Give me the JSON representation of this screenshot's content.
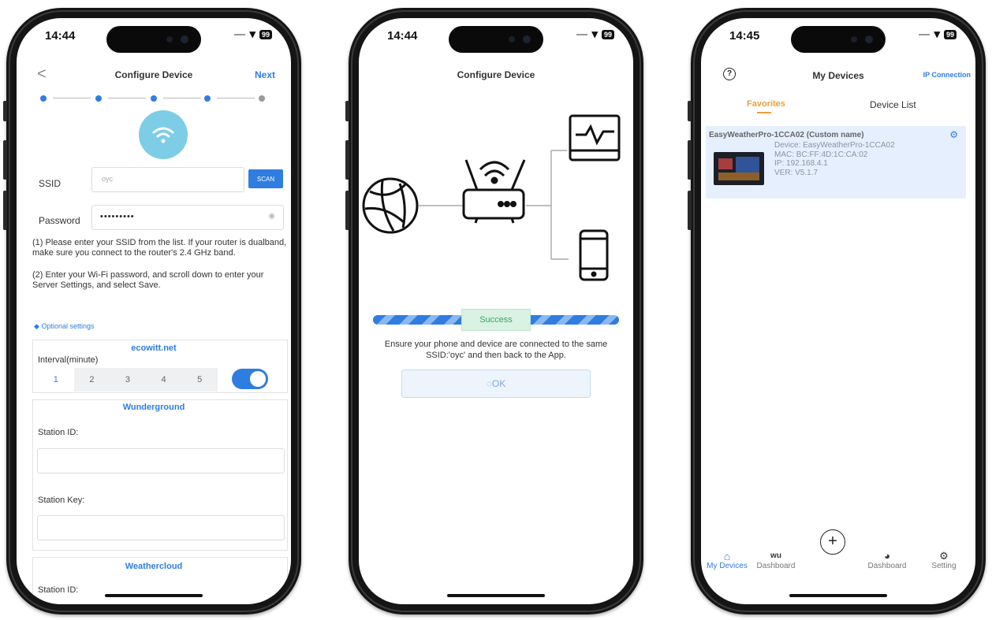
{
  "phone1": {
    "time": "14:44",
    "battery": "99",
    "nav": {
      "back": "<",
      "title": "Configure Device",
      "next": "Next"
    },
    "ssid": {
      "label": "SSID",
      "value": "oyc",
      "scan": "SCAN"
    },
    "password": {
      "label": "Password",
      "value": "•••••••••"
    },
    "instructions": [
      "(1) Please enter your SSID from the list. If your router is dualband, make sure you connect to the router's 2.4 GHz band.",
      "(2) Enter your Wi-Fi password, and scroll down to enter your Server Settings, and select Save."
    ],
    "optional": "Optional settings",
    "ecowitt": {
      "title": "ecowitt.net",
      "interval_label": "Interval(minute)",
      "intervals": [
        "1",
        "2",
        "3",
        "4",
        "5"
      ]
    },
    "wunderground": {
      "title": "Wunderground",
      "station_id": "Station ID:",
      "station_key": "Station Key:"
    },
    "weathercloud": {
      "title": "Weathercloud",
      "station_id": "Station ID:"
    }
  },
  "phone2": {
    "time": "14:44",
    "battery": "99",
    "title": "Configure Device",
    "success": "Success",
    "message_line1": "Ensure your phone and device are connected to the same",
    "message_line2": "SSID:'oyc' and then back to the App.",
    "ok": "OK"
  },
  "phone3": {
    "time": "14:45",
    "battery": "99",
    "help": "?",
    "title": "My Devices",
    "ip_connection": "IP Connection",
    "tabs": {
      "favorites": "Favorites",
      "device_list": "Device List"
    },
    "device": {
      "name": "EasyWeatherPro-1CCA02 (Custom name)",
      "device": "Device: EasyWeatherPro-1CCA02",
      "mac": "MAC: BC:FF:4D:1C:CA:02",
      "ip": "IP: 192.168.4.1",
      "ver": "VER: V5.1.7"
    },
    "tabbar": {
      "my_devices": "My Devices",
      "wu_icon_label": "wu",
      "dashboard1": "Dashboard",
      "add": "+",
      "dashboard2": "Dashboard",
      "setting": "Setting"
    }
  },
  "colors": {
    "accent": "#2f7de1",
    "favorites": "#e8a23a",
    "success": "#3aa36a",
    "card": "#e6effd"
  }
}
